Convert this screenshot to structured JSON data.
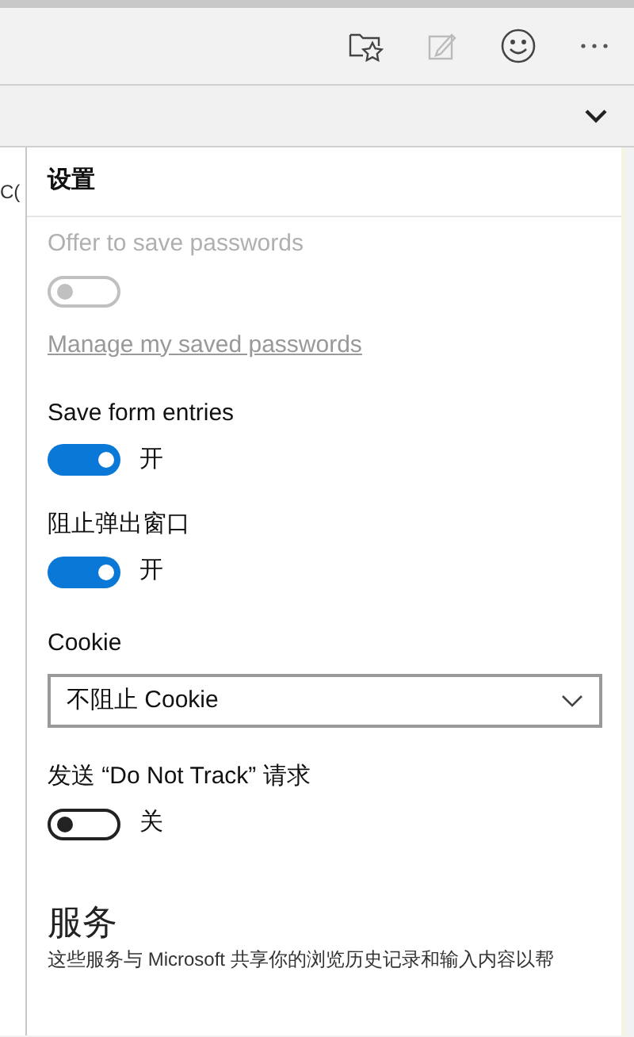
{
  "background_page": {
    "text_fragment": "C("
  },
  "panel": {
    "title": "设置"
  },
  "settings": [
    {
      "kind": "toggle",
      "label": "Offer to save passwords",
      "on": false,
      "disabled": true
    },
    {
      "kind": "link",
      "label": "Manage my saved passwords"
    },
    {
      "kind": "toggle",
      "label": "Save form entries",
      "on": true,
      "disabled": false,
      "state_text": "开"
    },
    {
      "kind": "toggle",
      "label": "阻止弹出窗口",
      "on": true,
      "disabled": false,
      "state_text": "开"
    },
    {
      "kind": "dropdown",
      "label": "Cookie",
      "value": "不阻止 Cookie"
    },
    {
      "kind": "toggle",
      "label": "发送 “Do Not Track” 请求",
      "on": false,
      "disabled": false,
      "state_text": "关"
    },
    {
      "kind": "section",
      "label": "服务",
      "description": "这些服务与 Microsoft 共享你的浏览历史记录和输入内容以帮"
    }
  ]
}
